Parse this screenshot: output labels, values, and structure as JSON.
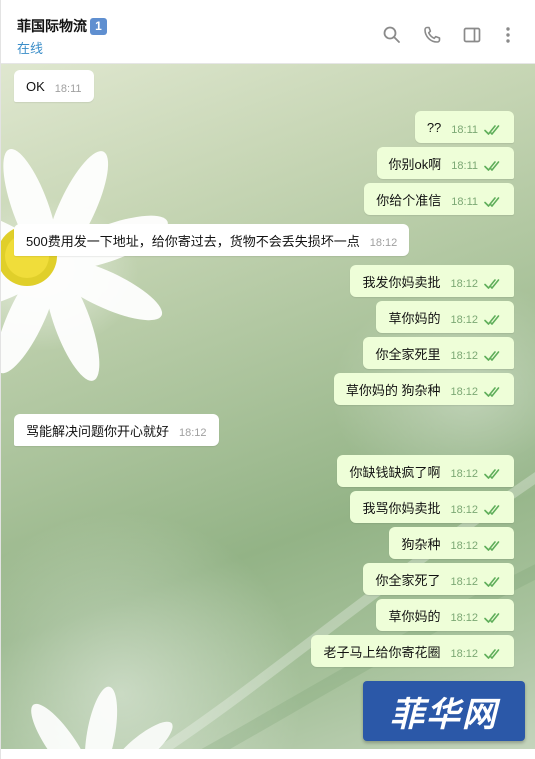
{
  "header": {
    "title": "菲国际物流",
    "badge": "1",
    "status": "在线",
    "icons": [
      "search-icon",
      "phone-icon",
      "sidebar-panel-icon",
      "more-vertical-icon"
    ]
  },
  "colors": {
    "status_blue": "#3a8dc8",
    "outgoing_bubble": "#eefed8",
    "incoming_bubble": "#ffffff",
    "read_ticks": "#5fae5a",
    "watermark_bg": "#2b58a8"
  },
  "messages": [
    {
      "dir": "in",
      "text": "OK",
      "time": "18:11"
    },
    {
      "dir": "out",
      "text": "??",
      "time": "18:11"
    },
    {
      "dir": "out",
      "text": "你别ok啊",
      "time": "18:11"
    },
    {
      "dir": "out",
      "text": "你给个准信",
      "time": "18:11"
    },
    {
      "dir": "in",
      "text": "500费用发一下地址，给你寄过去，货物不会丢失损坏一点",
      "time": "18:12"
    },
    {
      "dir": "out",
      "text": "我发你妈卖批",
      "time": "18:12"
    },
    {
      "dir": "out",
      "text": "草你妈的",
      "time": "18:12"
    },
    {
      "dir": "out",
      "text": "你全家死里",
      "time": "18:12"
    },
    {
      "dir": "out",
      "text": "草你妈的   狗杂种",
      "time": "18:12"
    },
    {
      "dir": "in",
      "text": "骂能解决问题你开心就好",
      "time": "18:12"
    },
    {
      "dir": "out",
      "text": "你缺钱缺疯了啊",
      "time": "18:12"
    },
    {
      "dir": "out",
      "text": "我骂你妈卖批",
      "time": "18:12"
    },
    {
      "dir": "out",
      "text": "狗杂种",
      "time": "18:12"
    },
    {
      "dir": "out",
      "text": "你全家死了",
      "time": "18:12"
    },
    {
      "dir": "out",
      "text": "草你妈的",
      "time": "18:12"
    },
    {
      "dir": "out",
      "text": "老子马上给你寄花圈",
      "time": "18:12"
    }
  ],
  "watermark": {
    "text": "菲华网"
  }
}
